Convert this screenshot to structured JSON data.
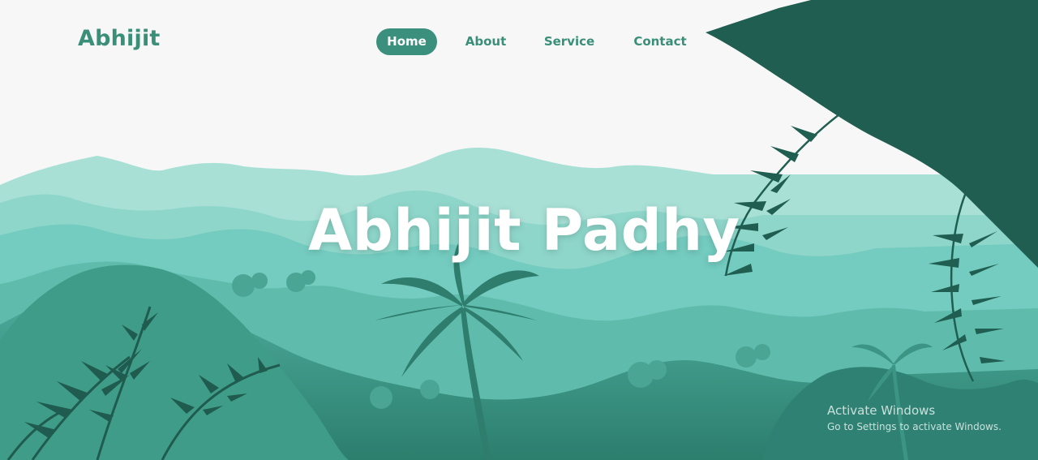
{
  "header": {
    "logo": "Abhijit",
    "nav": [
      {
        "label": "Home",
        "active": true
      },
      {
        "label": "About",
        "active": false
      },
      {
        "label": "Service",
        "active": false
      },
      {
        "label": "Contact",
        "active": false
      }
    ]
  },
  "hero": {
    "title": "Abhijit Padhy"
  },
  "os_watermark": {
    "title": "Activate Windows",
    "subtitle": "Go to Settings to activate Windows."
  },
  "colors": {
    "accent": "#3a8f7d",
    "background": "#f7f7f7",
    "mountain_light": "#a8e0d6",
    "mountain_mid": "#74cbbf",
    "foliage_dark": "#1e5e50"
  }
}
